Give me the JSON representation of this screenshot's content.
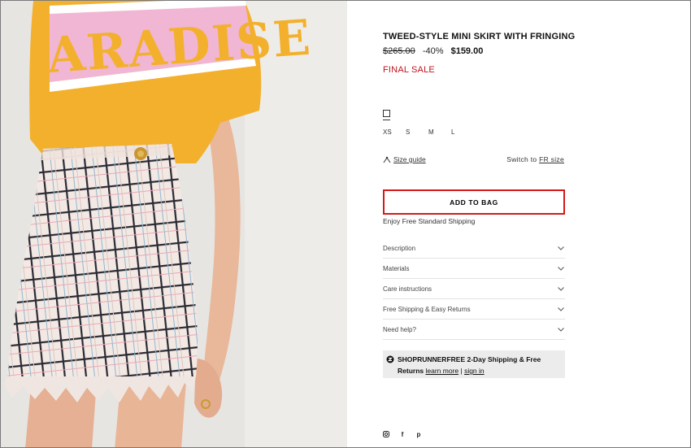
{
  "product": {
    "title": "TWEED-STYLE MINI SKIRT WITH FRINGING",
    "old_price": "$265.00",
    "discount": "-40%",
    "price": "$159.00",
    "sale_note": "FINAL SALE",
    "tshirt_print": "ARADISE"
  },
  "sizes": [
    "XS",
    "S",
    "M",
    "L"
  ],
  "size_guide": {
    "label": "Size guide"
  },
  "switch_size": {
    "prefix": "Switch to ",
    "link": "FR size"
  },
  "add_to_bag": {
    "label": "ADD TO BAG"
  },
  "shipping_note": "Enjoy Free Standard Shipping",
  "accordion": [
    {
      "label": "Description"
    },
    {
      "label": "Materials"
    },
    {
      "label": "Care instructions"
    },
    {
      "label": "Free Shipping & Easy Returns"
    },
    {
      "label": "Need help?"
    }
  ],
  "shoprunner": {
    "brand": "SHOPRUNNER",
    "line1": " FREE 2-Day Shipping & Free",
    "line2": "Returns ",
    "learn_more": "learn more",
    "separator": " | ",
    "sign_in": "sign in"
  },
  "social": {
    "instagram": "instagram-icon",
    "facebook": "f",
    "pinterest": "p"
  },
  "colors": {
    "sale_red": "#c0121e",
    "highlight_border": "#d31a1a",
    "panel_gray": "#ececec"
  }
}
